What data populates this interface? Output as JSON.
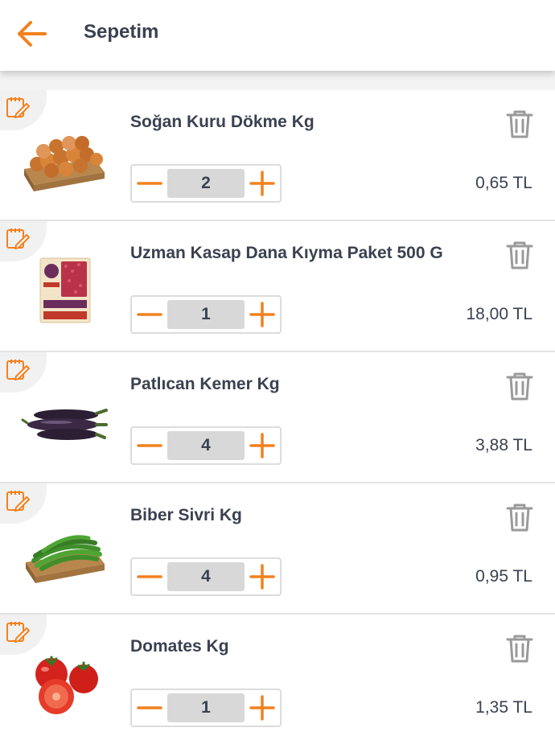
{
  "header": {
    "title": "Sepetim",
    "back_icon": "arrow-left-icon",
    "accent_color": "#F2811F"
  },
  "cart": {
    "items": [
      {
        "name": "Soğan Kuru Dökme Kg",
        "quantity": "2",
        "price": "0,65 TL"
      },
      {
        "name": "Uzman Kasap Dana Kıyma Paket 500 G",
        "quantity": "1",
        "price": "18,00 TL"
      },
      {
        "name": "Patlıcan Kemer Kg",
        "quantity": "4",
        "price": "3,88 TL"
      },
      {
        "name": "Biber Sivri Kg",
        "quantity": "4",
        "price": "0,95 TL"
      },
      {
        "name": "Domates Kg",
        "quantity": "1",
        "price": "1,35 TL"
      }
    ]
  },
  "icons": {
    "note": "note-edit-icon",
    "delete": "trash-icon",
    "decrease": "minus-icon",
    "increase": "plus-icon"
  }
}
